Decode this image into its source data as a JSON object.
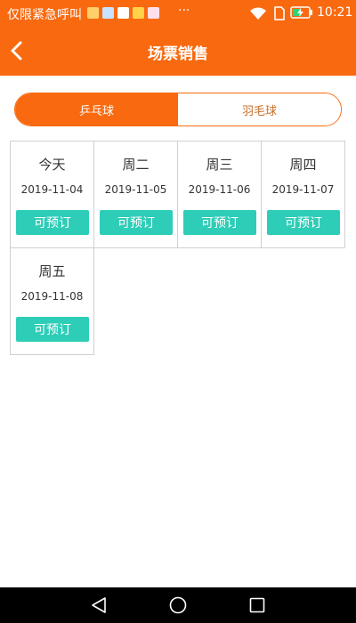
{
  "status_bar": {
    "carrier_text": "仅限紧急呼叫",
    "more_indicator": "···",
    "time": "10:21",
    "icons": [
      "wifi-icon",
      "sim-icon",
      "battery-charging-icon"
    ]
  },
  "header": {
    "title": "场票销售",
    "back_icon": "chevron-left-icon",
    "background": "#f96a10"
  },
  "sport_tabs": [
    {
      "label": "乒乓球",
      "selected": true
    },
    {
      "label": "羽毛球",
      "selected": false
    }
  ],
  "days": [
    {
      "day": "今天",
      "date": "2019-11-04",
      "button": "可预订"
    },
    {
      "day": "周二",
      "date": "2019-11-05",
      "button": "可预订"
    },
    {
      "day": "周三",
      "date": "2019-11-06",
      "button": "可预订"
    },
    {
      "day": "周四",
      "date": "2019-11-07",
      "button": "可预订"
    },
    {
      "day": "周五",
      "date": "2019-11-08",
      "button": "可预订"
    }
  ],
  "colors": {
    "accent": "#f96a10",
    "book_button": "#2ecdb7",
    "inactive_tab_text": "#c8702a"
  },
  "nav_bar": {
    "icons": [
      "back-triangle-icon",
      "home-circle-icon",
      "recents-square-icon"
    ]
  }
}
